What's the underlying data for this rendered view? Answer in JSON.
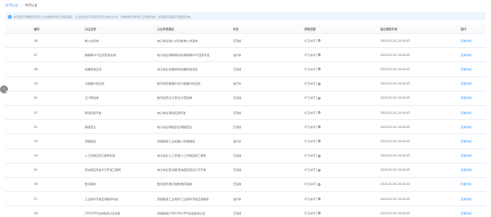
{
  "breadcrumb": {
    "link": "证书认证",
    "separator": "/",
    "current": "专项认证"
  },
  "notice": {
    "icon": "info-icon",
    "text": "本页面可查看各项专项认证的报考条件及考核进度，认证通过后可获得对应专业能力证书，具体规则请参阅认证说明文档，如有疑问请联系管理员咨询。"
  },
  "table": {
    "headers": [
      "编号",
      "认证名称",
      "认证考核路径",
      "状态",
      "获取进度",
      "最近更新时间",
      "操作"
    ],
    "rows": [
      {
        "no": "46",
        "name": "嵌入式系统",
        "path": "电子信息/嵌入式系统/嵌入式系统",
        "status": "已完成",
        "progress": "0门/共3门",
        "time": "2025-01-20 14:10:43",
        "op": "查看详情"
      },
      {
        "no": "47",
        "name": "物联网(IoT)应用开发系统",
        "path": "电子信息/物联网系统/物联网(IoT)应用开发",
        "status": "进行中",
        "progress": "0门/共3门",
        "time": "2025-01-20 14:10:43",
        "op": "查看详情"
      },
      {
        "no": "48",
        "name": "机器视觉应用",
        "path": "电子信息/机器视觉/机器视觉应用",
        "status": "已完成",
        "progress": "0门/共3门",
        "time": "2025-01-20 14:10:43",
        "op": "查看详情"
      },
      {
        "no": "49",
        "name": "大数据分析应用",
        "path": "数字经济/数据分析/大数据分析应用",
        "status": "进行中",
        "progress": "0门/共3门",
        "time": "2025-01-20 14:10:43",
        "op": "查看详情"
      },
      {
        "no": "50",
        "name": "云计算运维",
        "path": "数字经济/云计算/云计算运维",
        "status": "已完成",
        "progress": "0门/共3门",
        "time": "2025-01-20 14:10:43",
        "op": "查看详情"
      },
      {
        "no": "51",
        "name": "移动应用开发",
        "path": "电子信息/移动应用开发",
        "status": "已完成",
        "progress": "0门/共3门",
        "time": "2025-01-20 14:10:43",
        "op": "查看详情"
      },
      {
        "no": "52",
        "name": "网络安全",
        "path": "电子信息/网络安全/网络安全",
        "status": "已完成",
        "progress": "0门/共3门",
        "time": "2025-01-20 14:10:43",
        "op": "查看详情"
      },
      {
        "no": "53",
        "name": "智能制造",
        "path": "智能制造/工业机器人/智能制造",
        "status": "进行中",
        "progress": "0门/共3门",
        "time": "2025-01-20 14:10:43",
        "op": "查看详情"
      },
      {
        "no": "54",
        "name": "人工智能应用工程师系统",
        "path": "电子信息/人工智能/人工智能应用工程师",
        "status": "已完成",
        "progress": "0门/共3门",
        "time": "2025-01-20 14:10:43",
        "op": "查看详情"
      },
      {
        "no": "55",
        "name": "区块链应用设计与开发工程师",
        "path": "电子信息/区块链/区块链应用设计与开发",
        "status": "已完成",
        "progress": "0门/共3门",
        "time": "2025-01-20 14:10:43",
        "op": "查看详情"
      },
      {
        "no": "56",
        "name": "数字媒体",
        "path": "数字经济/数字媒体/数字媒体",
        "status": "已完成",
        "progress": "0门/共3门",
        "time": "2025-01-20 14:10:43",
        "op": "查看详情"
      },
      {
        "no": "57",
        "name": "工业软件开发应用程序系统",
        "path": "智能制造/工业软件/工业软件开发应用程序",
        "status": "进行中",
        "progress": "0门/共3门",
        "time": "2025-01-20 14:10:43",
        "op": "查看详情"
      },
      {
        "no": "58",
        "name": "CPS/CPPS全栈集成认证系统",
        "path": "智能制造/CPS/CPS/CPPS全栈集成认证",
        "status": "已完成",
        "progress": "0门/共3门",
        "time": "2025-01-20 14:10:43",
        "op": "查看详情"
      }
    ]
  },
  "colors": {
    "accent": "#409eff",
    "notice_bg": "#ecf5ff",
    "header_bg": "#fafafa",
    "border": "#ebeef5"
  }
}
